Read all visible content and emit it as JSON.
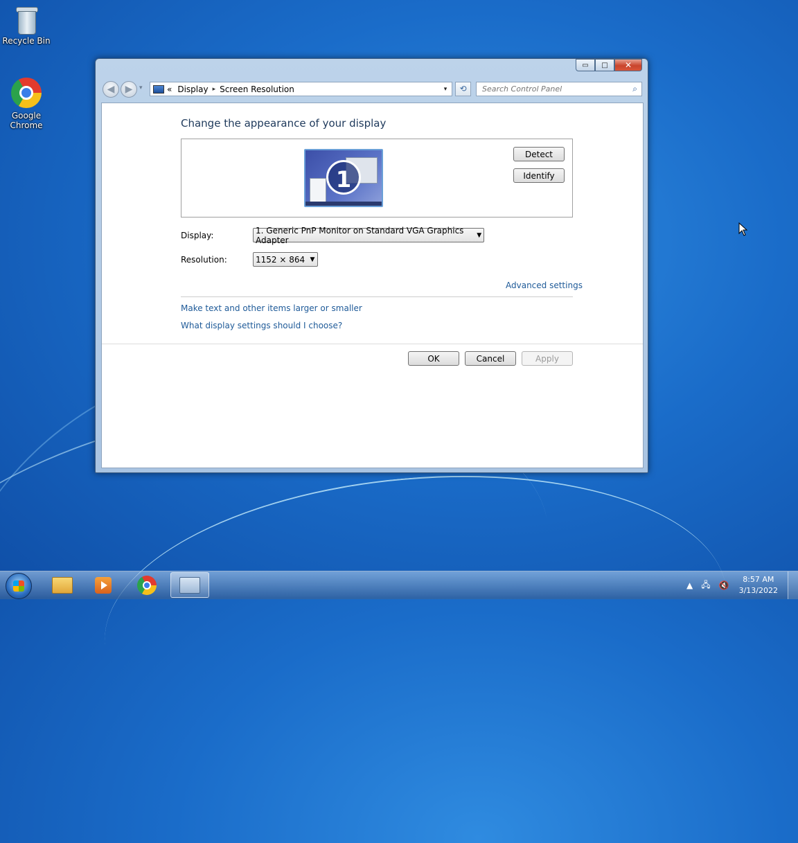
{
  "desktop": {
    "icons": [
      {
        "label": "Recycle Bin",
        "icon": "recycle-bin-icon"
      },
      {
        "label": "Google Chrome",
        "icon": "chrome-icon"
      }
    ]
  },
  "window": {
    "controls": {
      "minimize": "▭",
      "maximize": "□",
      "close": "✕"
    },
    "address": {
      "prefix": "«",
      "crumbs": [
        "Display",
        "Screen Resolution"
      ],
      "separator": "▸",
      "dropdown": "▾"
    },
    "refresh_icon": "⟲",
    "search": {
      "placeholder": "Search Control Panel",
      "icon": "⌕"
    },
    "page_title": "Change the appearance of your display",
    "monitor": {
      "number": "1"
    },
    "buttons": {
      "detect": "Detect",
      "identify": "Identify",
      "ok": "OK",
      "cancel": "Cancel",
      "apply": "Apply"
    },
    "display_label": "Display:",
    "display_value": "1. Generic PnP Monitor on Standard VGA Graphics Adapter",
    "resolution_label": "Resolution:",
    "resolution_value": "1152 × 864",
    "advanced_link": "Advanced settings",
    "links": [
      "Make text and other items larger or smaller",
      "What display settings should I choose?"
    ]
  },
  "taskbar": {
    "clock_time": "8:57 AM",
    "clock_date": "3/13/2022",
    "tray_up": "▲",
    "apps": [
      "windows-explorer",
      "windows-media-player",
      "google-chrome",
      "display-settings"
    ]
  },
  "colors": {
    "link": "#1e5a98",
    "title": "#1e395b",
    "desktop": "#1a6cc9"
  }
}
